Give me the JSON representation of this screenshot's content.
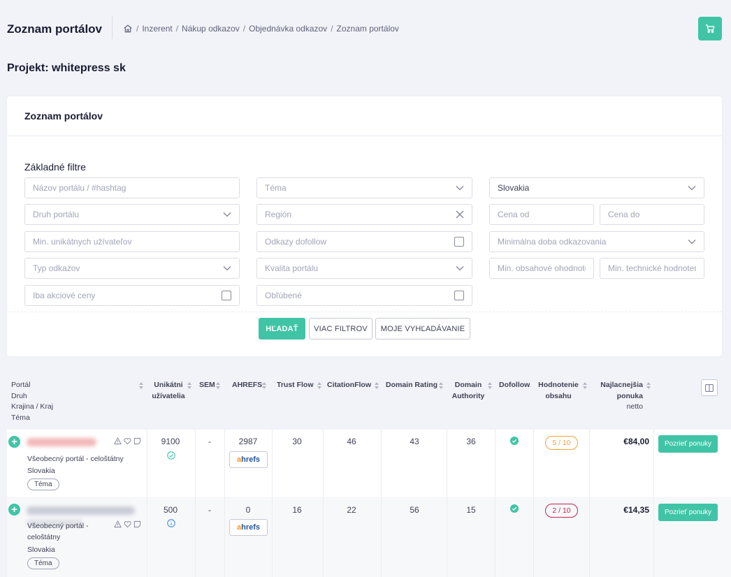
{
  "header": {
    "title": "Zoznam portálov",
    "breadcrumb": [
      "Inzerent",
      "Nákup odkazov",
      "Objednávka odkazov",
      "Zoznam portálov"
    ]
  },
  "project": "Projekt: whitepress sk",
  "card": {
    "title": "Zoznam portálov",
    "filters_title": "Základné filtre",
    "filters": {
      "portal_name": "Názov portálu / #hashtag",
      "topic": "Téma",
      "country": "Slovakia",
      "portal_type": "Druh portálu",
      "region": "Región",
      "price_from": "Cena od",
      "price_to": "Cena do",
      "min_unique_users": "Min. unikátnych užívateľov",
      "dofollow_links": "Odkazy dofollow",
      "min_link_duration": "Minimálna doba odkazovania",
      "link_type": "Typ odkazov",
      "portal_quality": "Kvalita portálu",
      "min_content_rating": "Min. obsahové ohodnotenie",
      "min_technical_rating": "Min. technické hodnotenie",
      "promo_prices": "Iba akciové ceny",
      "favorites": "Obľúbené"
    },
    "buttons": {
      "search": "HĽADAŤ",
      "more_filters": "VIAC FILTROV",
      "my_search": "MOJE VYHĽADÁVANIE"
    }
  },
  "table": {
    "headers": {
      "portal": [
        "Portál",
        "Druh",
        "Krajina / Kraj",
        "Téma"
      ],
      "unique_users": [
        "Unikátni",
        "užívatelia"
      ],
      "sem": "SEM",
      "ahrefs": "AHREFS",
      "trust_flow": "Trust Flow",
      "citation_flow": "CitationFlow",
      "domain_rating": "Domain Rating",
      "domain_authority": [
        "Domain",
        "Authority"
      ],
      "dofollow": "Dofollow",
      "content_rating": [
        "Hodnotenie",
        "obsahu"
      ],
      "best_offer": [
        "Najlacnejšia",
        "ponuka",
        "netto"
      ]
    },
    "rows": [
      {
        "portal_type": "Všeobecný portál - celoštátny",
        "country": "Slovakia",
        "tag": "Téma",
        "unique_users": "9100",
        "sem": "-",
        "ahrefs": "2987",
        "trust_flow": "30",
        "citation_flow": "46",
        "domain_rating": "43",
        "domain_authority": "36",
        "rating": "5 / 10",
        "price": "€84,00",
        "offer_label": "Pozrieť ponuky"
      },
      {
        "portal_type_1": "Všeobecný portál -",
        "portal_type_2": "celoštátny",
        "country": "Slovakia",
        "tag": "Téma",
        "unique_users": "500",
        "sem": "-",
        "ahrefs": "0",
        "trust_flow": "16",
        "citation_flow": "22",
        "domain_rating": "56",
        "domain_authority": "15",
        "rating": "2 / 10",
        "price": "€14,35",
        "offer_label": "Pozrieť ponuky"
      }
    ],
    "ahrefs_logo_a": "a",
    "ahrefs_logo_rest": "hrefs"
  },
  "colors": {
    "accent": "#40c4a6",
    "rating_orange": "#f0a33a",
    "rating_red": "#c0244a",
    "info_blue": "#3d8fe8"
  }
}
